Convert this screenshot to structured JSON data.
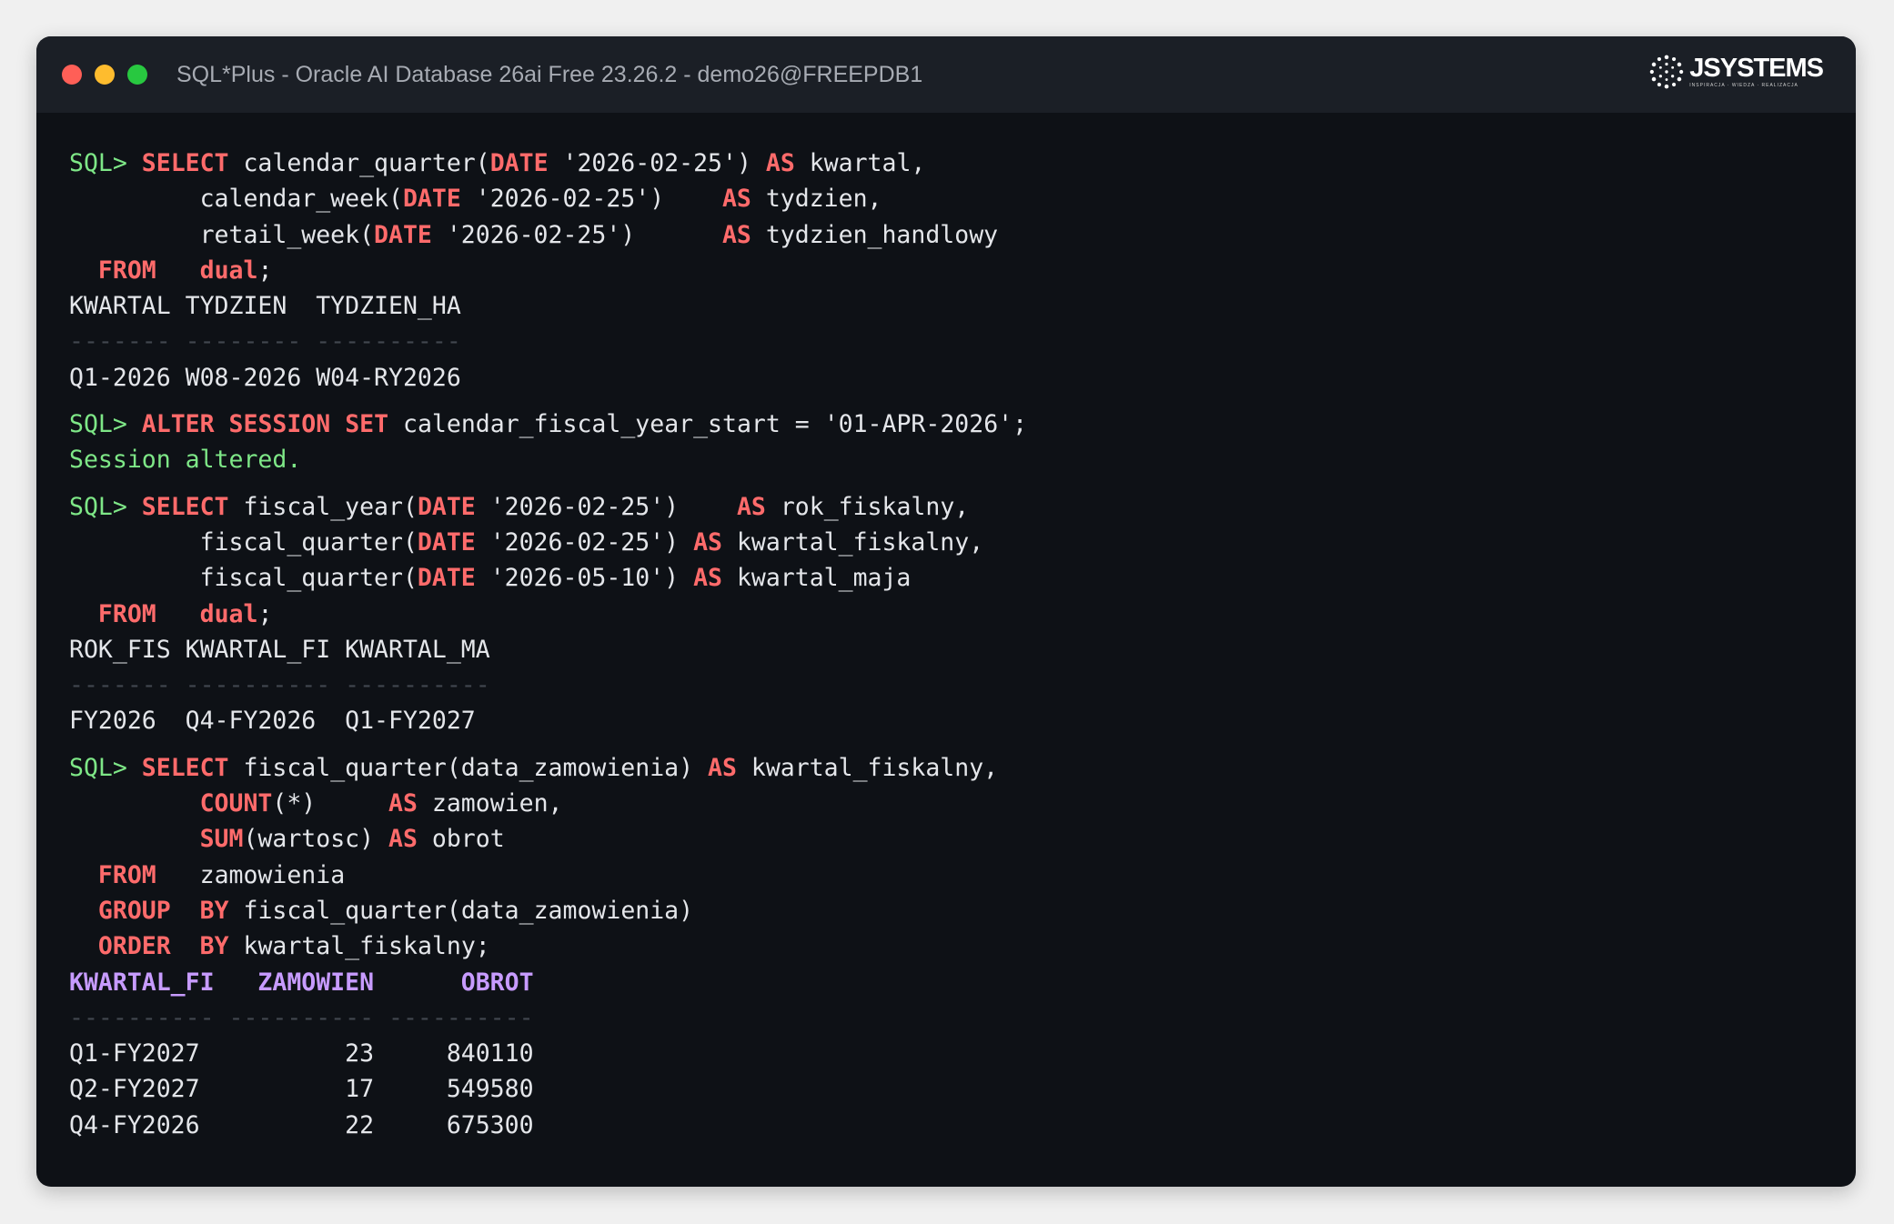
{
  "window": {
    "title": "SQL*Plus - Oracle AI Database 26ai Free 23.26.2 - demo26@FREEPDB1",
    "logo": {
      "name": "JSYSTEMS",
      "tagline": "INSPIRACJA · WIEDZA · REALIZACJA"
    }
  },
  "colors": {
    "keyword": "#ff6b6b",
    "prompt": "#7ee787",
    "header_highlight": "#c79bff",
    "background": "#0e1116",
    "titlebar": "#1b1f26"
  },
  "prompt": "SQL>",
  "query1": {
    "lines": [
      {
        "t": "SQL> ",
        "c": "prompt"
      },
      {
        "t": "SELECT",
        "c": "kw"
      },
      {
        "t": " calendar_quarter("
      },
      {
        "t": "DATE",
        "c": "kw"
      },
      {
        "t": " '2026-02-25') "
      },
      {
        "t": "AS",
        "c": "kw"
      },
      {
        "t": " kwartal,"
      }
    ],
    "l2": [
      {
        "t": "         calendar_week("
      },
      {
        "t": "DATE",
        "c": "kw"
      },
      {
        "t": " '2026-02-25')    "
      },
      {
        "t": "AS",
        "c": "kw"
      },
      {
        "t": " tydzien,"
      }
    ],
    "l3": [
      {
        "t": "         retail_week("
      },
      {
        "t": "DATE",
        "c": "kw"
      },
      {
        "t": " '2026-02-25')      "
      },
      {
        "t": "AS",
        "c": "kw"
      },
      {
        "t": " tydzien_handlowy"
      }
    ],
    "l4": [
      {
        "t": "  "
      },
      {
        "t": "FROM",
        "c": "kw"
      },
      {
        "t": "   "
      },
      {
        "t": "dual",
        "c": "kw"
      },
      {
        "t": ";"
      }
    ],
    "result_header": "KWARTAL TYDZIEN  TYDZIEN_HA",
    "result_separator": "------- -------- ----------",
    "result_rows": [
      "Q1-2026 W08-2026 W04-RY2026"
    ]
  },
  "alter": {
    "l1": [
      {
        "t": "SQL> ",
        "c": "prompt"
      },
      {
        "t": "ALTER",
        "c": "kw"
      },
      {
        "t": " "
      },
      {
        "t": "SESSION",
        "c": "kw"
      },
      {
        "t": " "
      },
      {
        "t": "SET",
        "c": "kw"
      },
      {
        "t": " calendar_fiscal_year_start = '01-APR-2026';"
      }
    ],
    "message": "Session altered."
  },
  "query2": {
    "l1": [
      {
        "t": "SQL> ",
        "c": "prompt"
      },
      {
        "t": "SELECT",
        "c": "kw"
      },
      {
        "t": " fiscal_year("
      },
      {
        "t": "DATE",
        "c": "kw"
      },
      {
        "t": " '2026-02-25')    "
      },
      {
        "t": "AS",
        "c": "kw"
      },
      {
        "t": " rok_fiskalny,"
      }
    ],
    "l2": [
      {
        "t": "         fiscal_quarter("
      },
      {
        "t": "DATE",
        "c": "kw"
      },
      {
        "t": " '2026-02-25') "
      },
      {
        "t": "AS",
        "c": "kw"
      },
      {
        "t": " kwartal_fiskalny,"
      }
    ],
    "l3": [
      {
        "t": "         fiscal_quarter("
      },
      {
        "t": "DATE",
        "c": "kw"
      },
      {
        "t": " '2026-05-10') "
      },
      {
        "t": "AS",
        "c": "kw"
      },
      {
        "t": " kwartal_maja"
      }
    ],
    "l4": [
      {
        "t": "  "
      },
      {
        "t": "FROM",
        "c": "kw"
      },
      {
        "t": "   "
      },
      {
        "t": "dual",
        "c": "kw"
      },
      {
        "t": ";"
      }
    ],
    "result_header": "ROK_FIS KWARTAL_FI KWARTAL_MA",
    "result_separator": "------- ---------- ----------",
    "result_rows": [
      "FY2026  Q4-FY2026  Q1-FY2027"
    ]
  },
  "query3": {
    "l1": [
      {
        "t": "SQL> ",
        "c": "prompt"
      },
      {
        "t": "SELECT",
        "c": "kw"
      },
      {
        "t": " fiscal_quarter(data_zamowienia) "
      },
      {
        "t": "AS",
        "c": "kw"
      },
      {
        "t": " kwartal_fiskalny,"
      }
    ],
    "l2": [
      {
        "t": "         "
      },
      {
        "t": "COUNT",
        "c": "kw"
      },
      {
        "t": "(*)     "
      },
      {
        "t": "AS",
        "c": "kw"
      },
      {
        "t": " zamowien,"
      }
    ],
    "l3": [
      {
        "t": "         "
      },
      {
        "t": "SUM",
        "c": "kw"
      },
      {
        "t": "(wartosc) "
      },
      {
        "t": "AS",
        "c": "kw"
      },
      {
        "t": " obrot"
      }
    ],
    "l4": [
      {
        "t": "  "
      },
      {
        "t": "FROM",
        "c": "kw"
      },
      {
        "t": "   zamowienia"
      }
    ],
    "l5": [
      {
        "t": "  "
      },
      {
        "t": "GROUP",
        "c": "kw"
      },
      {
        "t": "  "
      },
      {
        "t": "BY",
        "c": "kw"
      },
      {
        "t": " fiscal_quarter(data_zamowienia)"
      }
    ],
    "l6": [
      {
        "t": "  "
      },
      {
        "t": "ORDER",
        "c": "kw"
      },
      {
        "t": "  "
      },
      {
        "t": "BY",
        "c": "kw"
      },
      {
        "t": " kwartal_fiskalny;"
      }
    ],
    "result_header": "KWARTAL_FI   ZAMOWIEN      OBROT",
    "result_separator": "---------- ---------- ----------",
    "result_rows": [
      "Q1-FY2027          23     840110",
      "Q2-FY2027          17     549580",
      "Q4-FY2026          22     675300"
    ]
  }
}
